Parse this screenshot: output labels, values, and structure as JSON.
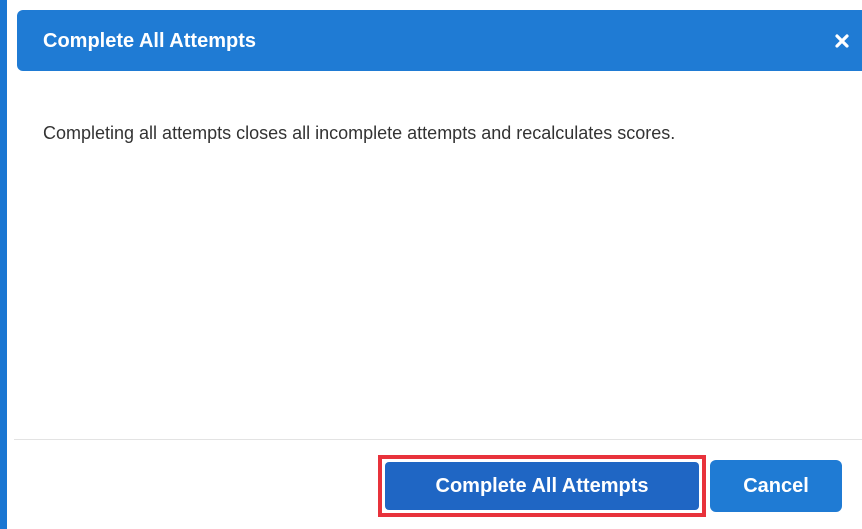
{
  "dialog": {
    "title": "Complete All Attempts",
    "close_icon": "close-icon",
    "message": "Completing all attempts closes all incomplete attempts and recalculates scores.",
    "footer": {
      "confirm_label": "Complete All Attempts",
      "cancel_label": "Cancel"
    }
  },
  "colors": {
    "header": "#1f7bd4",
    "primary_button": "#1f66c4",
    "highlight_outline": "#e8323b",
    "cancel_button": "#1f7bd4"
  }
}
